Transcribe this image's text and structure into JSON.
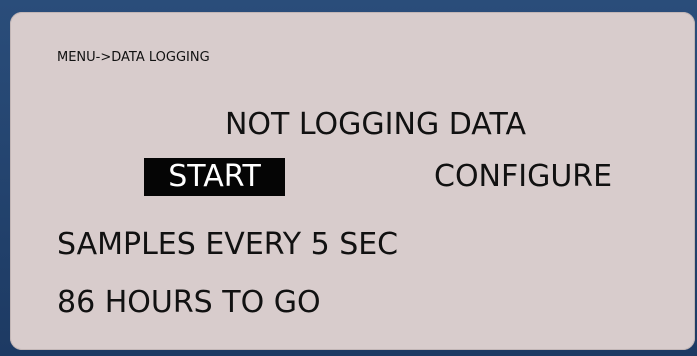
{
  "screen": {
    "breadcrumb": "MENU->DATA LOGGING",
    "status": "NOT LOGGING DATA",
    "buttons": {
      "start": "START",
      "configure": "CONFIGURE"
    },
    "selected_button": "START",
    "info": {
      "sample_interval": "SAMPLES EVERY 5 SEC",
      "time_remaining": "86 HOURS TO GO"
    }
  },
  "colors": {
    "frame": "#20406a",
    "screen_background": "#d8cccc",
    "text": "#111111",
    "selection_background": "#050505",
    "selection_text": "#ffffff"
  }
}
